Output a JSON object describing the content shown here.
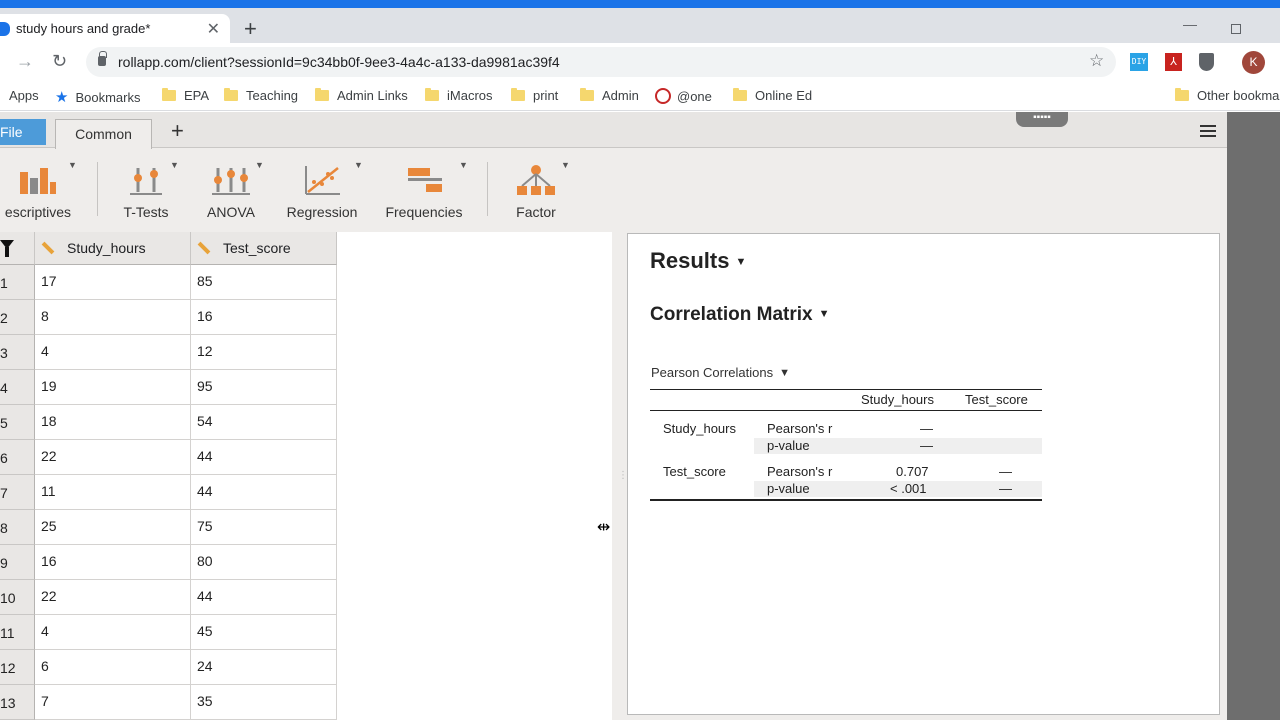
{
  "browser": {
    "tab_title": "study hours and grade*",
    "url": "rollapp.com/client?sessionId=9c34bb0f-9ee3-4a4c-a133-da9981ac39f4",
    "profile_initial": "K",
    "ext_diy": "DIY",
    "ext_pdf": "⅄",
    "bookmarks": {
      "apps": "Apps",
      "bookmarks": "Bookmarks",
      "epa": "EPA",
      "teaching": "Teaching",
      "admin_links": "Admin Links",
      "imacros": "iMacros",
      "print": "print",
      "admin": "Admin",
      "one": "@one",
      "online_ed": "Online Ed",
      "other": "Other bookma"
    }
  },
  "app": {
    "file_tab": "File",
    "common_tab": "Common",
    "add_tab": "+",
    "ribbon": {
      "descriptives": "escriptives",
      "ttests": "T-Tests",
      "anova": "ANOVA",
      "regression": "Regression",
      "frequencies": "Frequencies",
      "factor": "Factor"
    },
    "colors": {
      "file_tab": "#4d9bd9",
      "icon_orange": "#e8873a",
      "icon_gray": "#8a8a8a",
      "scrollbar_gray": "#6e6e6e"
    }
  },
  "sheet": {
    "col1": "Study_hours",
    "col2": "Test_score",
    "rows": [
      {
        "n": "1",
        "a": "17",
        "b": "85"
      },
      {
        "n": "2",
        "a": "8",
        "b": "16"
      },
      {
        "n": "3",
        "a": "4",
        "b": "12"
      },
      {
        "n": "4",
        "a": "19",
        "b": "95"
      },
      {
        "n": "5",
        "a": "18",
        "b": "54"
      },
      {
        "n": "6",
        "a": "22",
        "b": "44"
      },
      {
        "n": "7",
        "a": "11",
        "b": "44"
      },
      {
        "n": "8",
        "a": "25",
        "b": "75"
      },
      {
        "n": "9",
        "a": "16",
        "b": "80"
      },
      {
        "n": "10",
        "a": "22",
        "b": "44"
      },
      {
        "n": "11",
        "a": "4",
        "b": "45"
      },
      {
        "n": "12",
        "a": "6",
        "b": "24"
      },
      {
        "n": "13",
        "a": "7",
        "b": "35"
      }
    ]
  },
  "results": {
    "title": "Results",
    "subtitle": "Correlation Matrix",
    "table_title": "Pearson Correlations",
    "col_study": "Study_hours",
    "col_test": "Test_score",
    "row1": {
      "label": "Study_hours",
      "r_label": "Pearson's r",
      "p_label": "p-value",
      "r_study": "—",
      "p_study": "—"
    },
    "row2": {
      "label": "Test_score",
      "r_label": "Pearson's r",
      "p_label": "p-value",
      "r_study": "0.707",
      "r_test": "—",
      "p_study": "< .001",
      "p_test": "—"
    }
  }
}
